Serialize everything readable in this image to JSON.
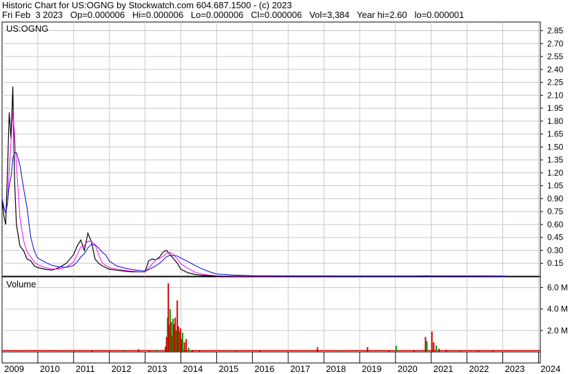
{
  "header": {
    "line1": "Historic Chart for US:OGNG by Stockwatch.com 604.687.1500 - (c) 2023",
    "line2": "Fri Feb  3 2023   Op=0.000006   Hi=0.000006   Lo=0.000006   Cl=0.000006   Vol=3,384   Year hi=2.60   lo=0.000001"
  },
  "chart_data": [
    {
      "type": "line",
      "title": "US:OGNG",
      "ylim": [
        0,
        2.95
      ],
      "yticks": [
        "0.15",
        "0.30",
        "0.45",
        "0.60",
        "0.75",
        "0.90",
        "1.05",
        "1.20",
        "1.35",
        "1.50",
        "1.65",
        "1.80",
        "1.95",
        "2.10",
        "2.25",
        "2.40",
        "2.55",
        "2.70",
        "2.85"
      ],
      "x_years": [
        "2009",
        "2010",
        "2011",
        "2012",
        "2013",
        "2014",
        "2015",
        "2016",
        "2017",
        "2018",
        "2019",
        "2020",
        "2021",
        "2022",
        "2023",
        "2024"
      ],
      "grid": true,
      "series": [
        {
          "x": [
            2009.0,
            2009.05,
            2009.1,
            2009.15,
            2009.2,
            2009.25,
            2009.3,
            2009.35,
            2009.4,
            2009.5,
            2009.6,
            2009.7,
            2009.8,
            2009.9,
            2010.0,
            2010.2,
            2010.4,
            2010.6,
            2010.8,
            2011.0,
            2011.1,
            2011.2,
            2011.3,
            2011.4,
            2011.5,
            2011.6,
            2011.7,
            2011.8,
            2011.9,
            2012.0,
            2012.2,
            2012.4,
            2012.6,
            2012.8,
            2013.0,
            2013.1,
            2013.2,
            2013.3,
            2013.4,
            2013.5,
            2013.6,
            2013.7,
            2013.8,
            2013.9,
            2014.0,
            2014.2,
            2014.4,
            2014.6,
            2014.8,
            2015.0,
            2015.5,
            2016.0,
            2017.0,
            2018.0,
            2019.0,
            2020.0,
            2020.5,
            2020.8,
            2021.0,
            2021.5,
            2022.0,
            2022.5,
            2022.8,
            2023.1
          ],
          "close": [
            0.9,
            0.7,
            0.6,
            1.2,
            1.9,
            1.6,
            2.2,
            1.1,
            0.6,
            0.35,
            0.3,
            0.2,
            0.18,
            0.12,
            0.1,
            0.08,
            0.07,
            0.1,
            0.15,
            0.25,
            0.35,
            0.42,
            0.3,
            0.5,
            0.4,
            0.2,
            0.15,
            0.12,
            0.1,
            0.08,
            0.07,
            0.06,
            0.05,
            0.05,
            0.05,
            0.18,
            0.2,
            0.19,
            0.22,
            0.28,
            0.3,
            0.25,
            0.2,
            0.15,
            0.08,
            0.04,
            0.02,
            0.01,
            0.005,
            0.002,
            0.001,
            0.001,
            0.0008,
            0.0006,
            0.0005,
            0.0005,
            0.0006,
            0.004,
            0.002,
            0.001,
            0.0008,
            0.0005,
            0.0003,
            6e-06
          ]
        }
      ],
      "volume": {
        "title": "Volume",
        "ylim": [
          0,
          7.0
        ],
        "yticks": [
          "2.0 M",
          "4.0 M",
          "6.0 M"
        ],
        "spikes": [
          {
            "x": 2009.1,
            "v": 0.05
          },
          {
            "x": 2009.5,
            "v": 0.05
          },
          {
            "x": 2010.5,
            "v": 0.05
          },
          {
            "x": 2011.0,
            "v": 0.1
          },
          {
            "x": 2011.5,
            "v": 0.1
          },
          {
            "x": 2012.0,
            "v": 0.06
          },
          {
            "x": 2012.4,
            "v": 0.15
          },
          {
            "x": 2012.8,
            "v": 0.25
          },
          {
            "x": 2013.1,
            "v": 0.1
          },
          {
            "x": 2013.3,
            "v": 0.2
          },
          {
            "x": 2013.55,
            "v": 0.5
          },
          {
            "x": 2013.58,
            "v": 1.4
          },
          {
            "x": 2013.61,
            "v": 3.2
          },
          {
            "x": 2013.63,
            "v": 6.4
          },
          {
            "x": 2013.65,
            "v": 2.5
          },
          {
            "x": 2013.68,
            "v": 4.0
          },
          {
            "x": 2013.71,
            "v": 2.8
          },
          {
            "x": 2013.73,
            "v": 1.5
          },
          {
            "x": 2013.76,
            "v": 3.1
          },
          {
            "x": 2013.79,
            "v": 2.6
          },
          {
            "x": 2013.82,
            "v": 3.2
          },
          {
            "x": 2013.85,
            "v": 2.0
          },
          {
            "x": 2013.88,
            "v": 4.8
          },
          {
            "x": 2013.91,
            "v": 2.4
          },
          {
            "x": 2013.94,
            "v": 1.9
          },
          {
            "x": 2013.97,
            "v": 2.2
          },
          {
            "x": 2014.0,
            "v": 1.2
          },
          {
            "x": 2014.03,
            "v": 1.8
          },
          {
            "x": 2014.08,
            "v": 0.9
          },
          {
            "x": 2014.13,
            "v": 1.2
          },
          {
            "x": 2014.2,
            "v": 0.4
          },
          {
            "x": 2014.3,
            "v": 0.2
          },
          {
            "x": 2014.5,
            "v": 0.1
          },
          {
            "x": 2015.5,
            "v": 0.1
          },
          {
            "x": 2016.2,
            "v": 0.1
          },
          {
            "x": 2017.8,
            "v": 0.45
          },
          {
            "x": 2018.4,
            "v": 0.15
          },
          {
            "x": 2019.2,
            "v": 0.45
          },
          {
            "x": 2019.8,
            "v": 0.15
          },
          {
            "x": 2020.0,
            "v": 0.6
          },
          {
            "x": 2020.5,
            "v": 0.1
          },
          {
            "x": 2020.82,
            "v": 1.4
          },
          {
            "x": 2020.86,
            "v": 1.0
          },
          {
            "x": 2021.0,
            "v": 1.9
          },
          {
            "x": 2021.05,
            "v": 0.9
          },
          {
            "x": 2021.12,
            "v": 0.6
          },
          {
            "x": 2021.2,
            "v": 0.3
          },
          {
            "x": 2021.4,
            "v": 0.2
          },
          {
            "x": 2021.8,
            "v": 0.1
          },
          {
            "x": 2022.3,
            "v": 0.1
          },
          {
            "x": 2022.7,
            "v": 0.1
          }
        ]
      }
    }
  ],
  "colors": {
    "grid": "#c8c8c8",
    "up": "#00a000",
    "down": "#d00000",
    "price": "#000000",
    "ma_short": "#ff00ff",
    "ma_long": "#0000cc",
    "frame": "#000000"
  }
}
